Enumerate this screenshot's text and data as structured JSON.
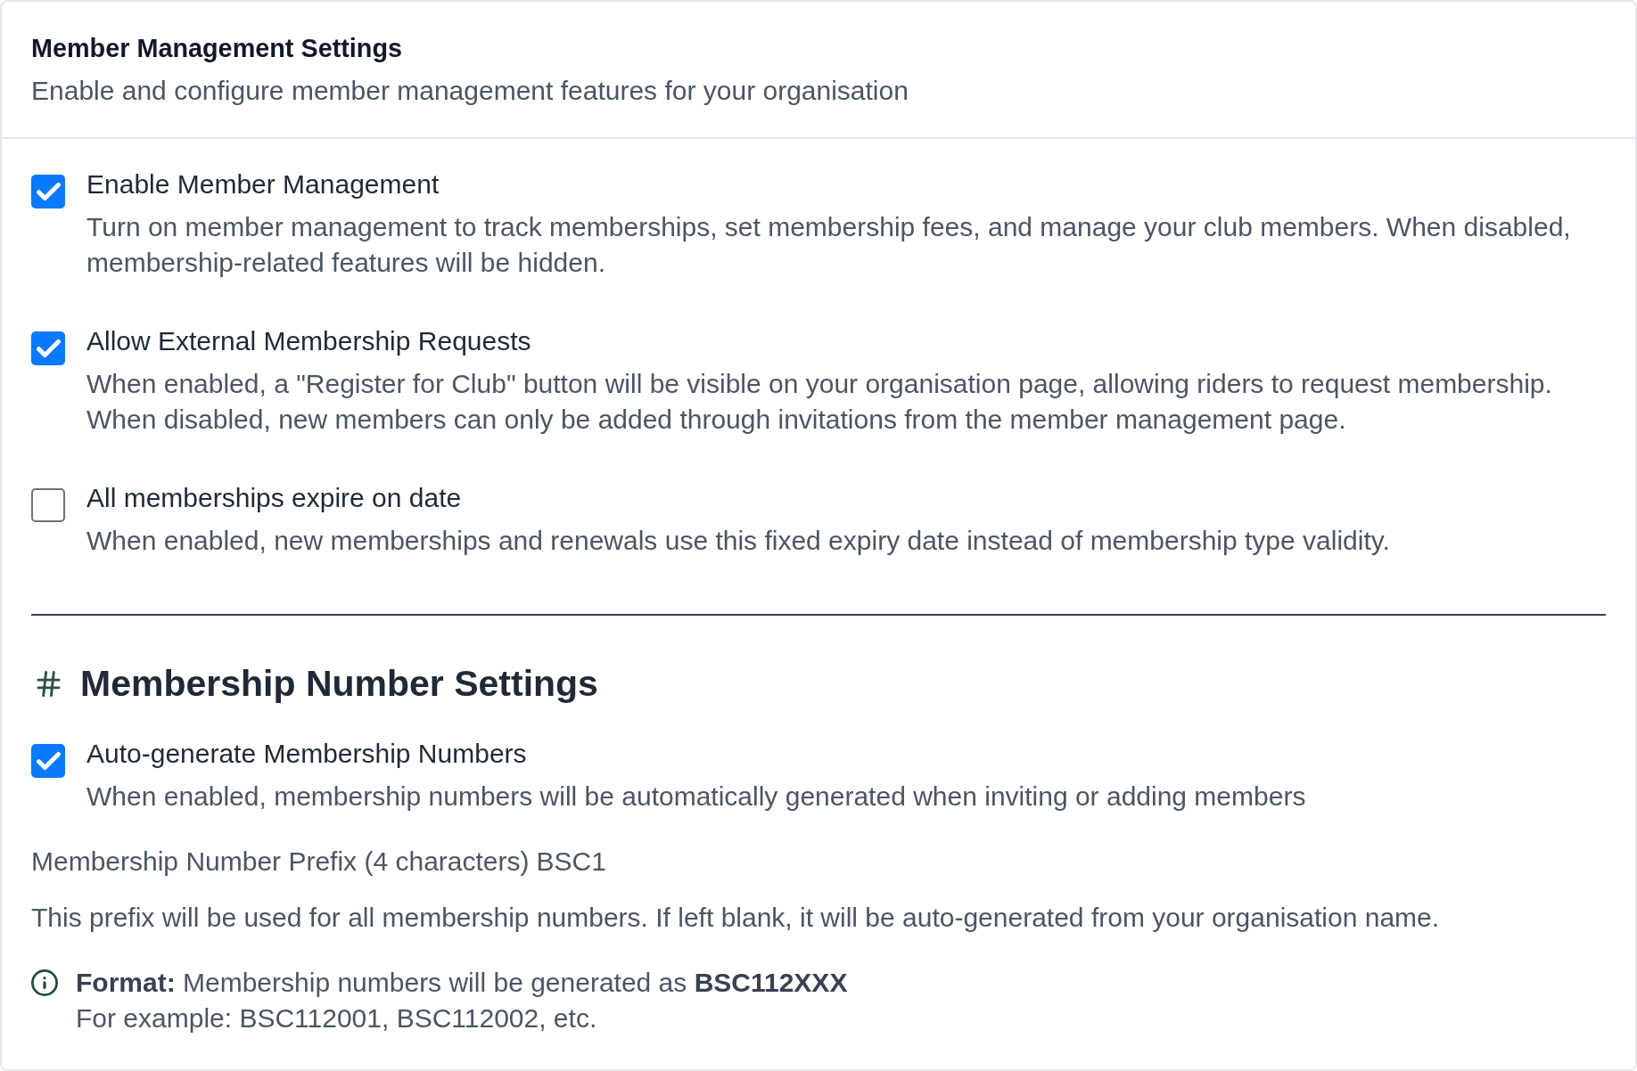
{
  "header": {
    "title": "Member Management Settings",
    "subtitle": "Enable and configure member management features for your organisation"
  },
  "settings": [
    {
      "label": "Enable Member Management",
      "description": "Turn on member management to track memberships, set membership fees, and manage your club members. When disabled, membership-related features will be hidden.",
      "checked": true
    },
    {
      "label": "Allow External Membership Requests",
      "description": "When enabled, a \"Register for Club\" button will be visible on your organisation page, allowing riders to request membership. When disabled, new members can only be added through invitations from the member management page.",
      "checked": true
    },
    {
      "label": "All memberships expire on date",
      "description": "When enabled, new memberships and renewals use this fixed expiry date instead of membership type validity.",
      "checked": false
    }
  ],
  "membership_numbers": {
    "heading": "Membership Number Settings",
    "settings": [
      {
        "label": "Auto-generate Membership Numbers",
        "description": "When enabled, membership numbers will be automatically generated when inviting or adding members",
        "checked": true
      }
    ],
    "prefix": {
      "label": "Membership Number Prefix (4 characters)",
      "value": "BSC1"
    },
    "help": "This prefix will be used for all membership numbers. If left blank, it will be auto-generated from your organisation name.",
    "format_note": {
      "text": "**Format:** Membership numbers will be generated as **BSC112XXX**",
      "example": "For example: BSC112001, BSC112002, etc."
    }
  }
}
